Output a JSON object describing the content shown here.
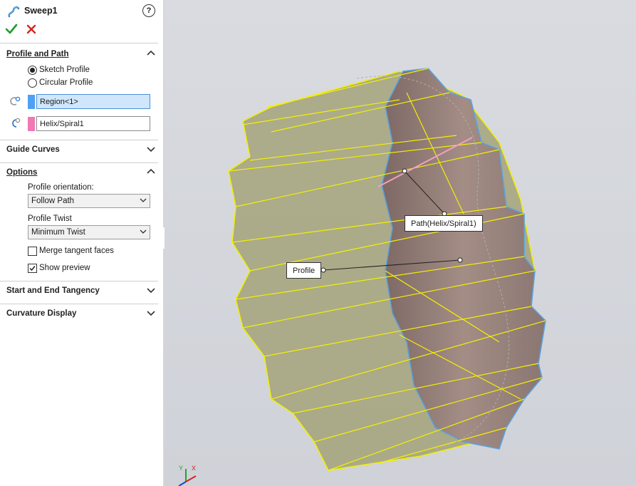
{
  "feature": {
    "title": "Sweep1"
  },
  "sections": {
    "profile_and_path": {
      "title": "Profile and Path",
      "options": [
        "Sketch Profile",
        "Circular Profile"
      ],
      "selected_option": "Sketch Profile",
      "profile_value": "Region<1>",
      "path_value": "Helix/Spiral1"
    },
    "guide_curves": {
      "title": "Guide Curves"
    },
    "options": {
      "title": "Options",
      "profile_orientation_label": "Profile orientation:",
      "profile_orientation_value": "Follow Path",
      "profile_twist_label": "Profile Twist",
      "profile_twist_value": "Minimum Twist",
      "merge_tangent_faces_label": "Merge tangent faces",
      "merge_tangent_faces_checked": false,
      "show_preview_label": "Show preview",
      "show_preview_checked": true
    },
    "start_end_tangency": {
      "title": "Start and End Tangency"
    },
    "curvature_display": {
      "title": "Curvature Display"
    }
  },
  "viewport": {
    "callouts": {
      "path": "Path(Helix/Spiral1)",
      "profile": "Profile"
    },
    "triad_axes": [
      "Y",
      "X"
    ]
  },
  "colors": {
    "accent_ok": "#1f9b2c",
    "accent_cancel": "#d6251c",
    "profile_swatch": "#4ea1f0",
    "path_swatch": "#f078b4",
    "preview_yellow": "#f3f000",
    "gear_fill": "#8f7872",
    "edge_blue": "#5aa2e0"
  }
}
